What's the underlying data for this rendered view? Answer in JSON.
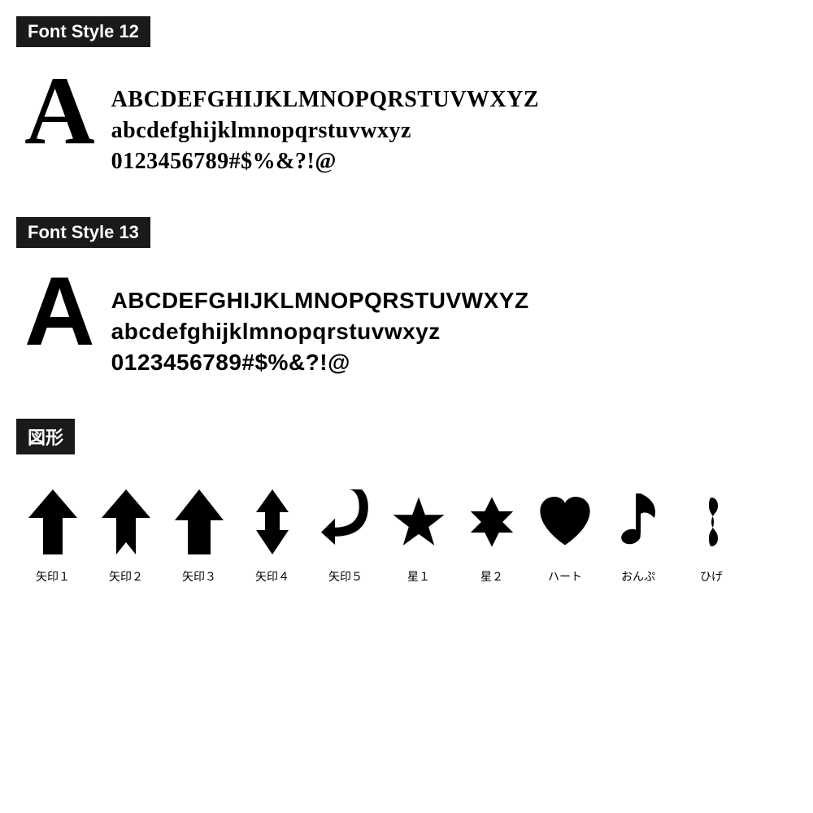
{
  "font12": {
    "header": "Font Style 12",
    "bigLetter": "A",
    "line1": "ABCDEFGHIJKLMNOPQRSTUVWXYZ",
    "line2": "abcdefghijklmnopqrstuvwxyz",
    "line3": "0123456789#$%&?!@"
  },
  "font13": {
    "header": "Font Style 13",
    "bigLetter": "A",
    "line1": "ABCDEFGHIJKLMNOPQRSTUVWXYZ",
    "line2": "abcdefghijklmnopqrstuvwxyz",
    "line3": "0123456789#$%&?!@"
  },
  "shapes": {
    "header": "図形",
    "items": [
      {
        "label": "矢印１"
      },
      {
        "label": "矢印２"
      },
      {
        "label": "矢印３"
      },
      {
        "label": "矢印４"
      },
      {
        "label": "矢印５"
      },
      {
        "label": "星１"
      },
      {
        "label": "星２"
      },
      {
        "label": "ハート"
      },
      {
        "label": "おんぷ"
      },
      {
        "label": "ひげ"
      }
    ]
  }
}
